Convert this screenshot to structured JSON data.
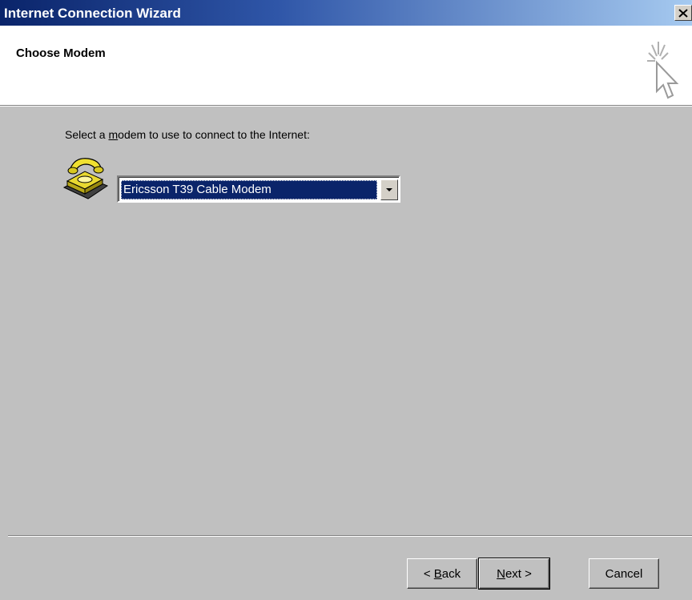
{
  "window": {
    "title": "Internet Connection Wizard",
    "close_glyph": "×"
  },
  "header": {
    "page_title": "Choose Modem",
    "icon": "wizard-cursor-icon"
  },
  "main": {
    "prompt_before": "Select a ",
    "prompt_mnemonic": "m",
    "prompt_after": "odem to use to connect to the Internet:",
    "modem_icon": "telephone-icon",
    "modem_select": {
      "selected": "Ericsson T39 Cable Modem"
    }
  },
  "footer": {
    "back_prefix": "< ",
    "back_mnemonic": "B",
    "back_rest": "ack",
    "next_mnemonic": "N",
    "next_rest": "ext >",
    "cancel_label": "Cancel"
  },
  "colors": {
    "title_bar_start": "#0a246a",
    "selection": "#0a246a",
    "dialog_bg": "#c0c0c0"
  }
}
